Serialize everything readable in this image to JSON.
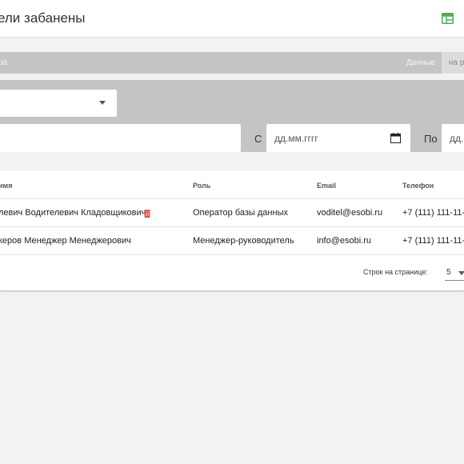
{
  "header": {
    "title": "ели забанены"
  },
  "filters": {
    "crumb": "ра",
    "data_label": "Данные",
    "date_tab": "на р",
    "from_label": "С",
    "to_label": "По",
    "date_from_placeholder": "дд.мм.гггг",
    "date_to_placeholder": "дд."
  },
  "table": {
    "headers": {
      "name": "имя",
      "role": "Роль",
      "email": "Email",
      "phone": "Телефон"
    },
    "rows": [
      {
        "name": "левич Водителевич Кладовщикович",
        "role": "Оператор базы данных",
        "email": "voditel@esobi.ru",
        "phone": "+7 (111) 111-11-1"
      },
      {
        "name": "керов Менеджер Менеджерович",
        "role": "Менеджер-руководитель",
        "email": "info@esobi.ru",
        "phone": "+7 (111) 111-11-1"
      }
    ],
    "footer": {
      "rows_per_page_label": "Строк на странице:",
      "rows_per_page_value": "5"
    }
  },
  "icons": {
    "layout": "layout-icon",
    "trash": "trash-icon",
    "calendar": "calendar-icon"
  },
  "colors": {
    "accent_green": "#4caf50",
    "delete_red": "#e53935",
    "filter_gray": "#c4c4c4"
  }
}
